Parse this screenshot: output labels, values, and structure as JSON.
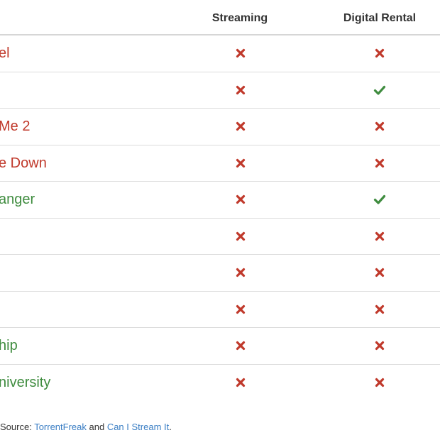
{
  "table": {
    "columns": [
      "Streaming",
      "Digital Rental"
    ],
    "rows": [
      {
        "title": "el",
        "title_color": "#c0392b",
        "streaming": "cross",
        "rental": "cross"
      },
      {
        "title": "",
        "title_color": "#c0392b",
        "streaming": "cross",
        "rental": "check"
      },
      {
        "title": "Me 2",
        "title_color": "#c0392b",
        "streaming": "cross",
        "rental": "cross"
      },
      {
        "title": "e Down",
        "title_color": "#c0392b",
        "streaming": "cross",
        "rental": "cross"
      },
      {
        "title": "anger",
        "title_color": "#3f8c3f",
        "streaming": "cross",
        "rental": "check"
      },
      {
        "title": "",
        "title_color": "#c0392b",
        "streaming": "cross",
        "rental": "cross"
      },
      {
        "title": "",
        "title_color": "#c0392b",
        "streaming": "cross",
        "rental": "cross"
      },
      {
        "title": "",
        "title_color": "#c0392b",
        "streaming": "cross",
        "rental": "cross"
      },
      {
        "title": "hip",
        "title_color": "#3f8c3f",
        "streaming": "cross",
        "rental": "cross"
      },
      {
        "title": "niversity",
        "title_color": "#3f8c3f",
        "streaming": "cross",
        "rental": "cross"
      }
    ]
  },
  "footer": {
    "prefix": "Source: ",
    "link1": "TorrentFreak",
    "middle": " and ",
    "link2": "Can I Stream It",
    "suffix": "."
  },
  "colors": {
    "cross": "#c0392b",
    "check": "#3f8c3f",
    "link": "#3a7ec4"
  },
  "icons": {
    "cross": "cross-icon",
    "check": "check-icon"
  }
}
